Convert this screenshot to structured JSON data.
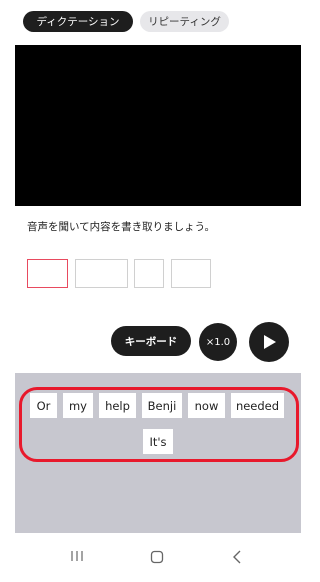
{
  "tabs": [
    {
      "label": "ディクテーション",
      "active": true
    },
    {
      "label": "リピーティング",
      "active": false
    }
  ],
  "instruction": "音声を聞いて内容を書き取りましょう。",
  "controls": {
    "keyboard_label": "キーボード",
    "speed_label": "×1.0"
  },
  "word_bank": [
    "Or",
    "my",
    "help",
    "Benji",
    "now",
    "needed",
    "It's"
  ],
  "colors": {
    "accent_dark": "#1e1e1e",
    "highlight_red": "#e8192c",
    "active_box_border": "#e84a5f",
    "word_bank_bg": "#c7c7cf"
  },
  "icons": {
    "play": "play-icon",
    "nav_recent": "recent-apps-icon",
    "nav_home": "home-icon",
    "nav_back": "back-icon"
  }
}
